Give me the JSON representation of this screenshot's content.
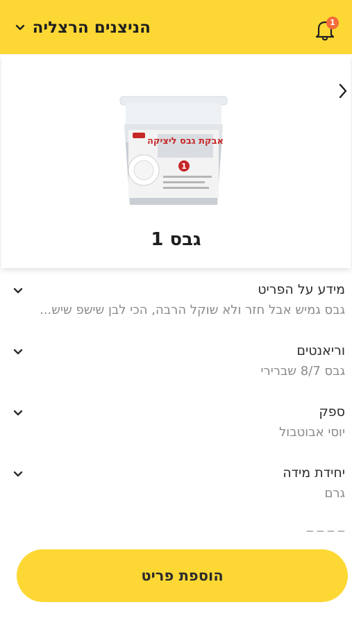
{
  "header": {
    "title": "הניצנים הרצליה",
    "notification_count": "1"
  },
  "product": {
    "name": "גבס 1",
    "package_text": "אבקת גבס ליציקה"
  },
  "sections": [
    {
      "label": "מידע על הפריט",
      "value": "גבס גמיש אבל חזר ולא שוקל הרבה, הכי לבן שישפ שיש..."
    },
    {
      "label": "וריאנטים",
      "value": "גבס 8/7 שברירי"
    },
    {
      "label": "ספק",
      "value": "יוסי אבוטבול"
    },
    {
      "label": "יחידת מידה",
      "value": "גרם"
    }
  ],
  "actions": {
    "add_item": "הוספת פריט"
  },
  "colors": {
    "accent": "#fdd835",
    "badge": "#f26b3a",
    "product_label_red": "#c62828"
  }
}
